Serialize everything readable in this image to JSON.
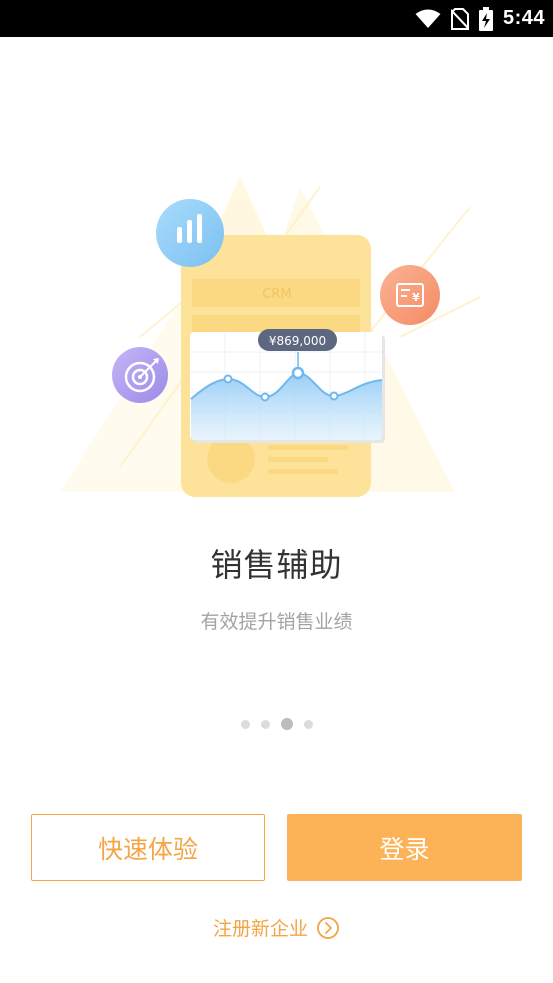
{
  "status_bar": {
    "time": "5:44",
    "icons": [
      "wifi-icon",
      "no-sim-icon",
      "battery-charging-icon"
    ]
  },
  "hero": {
    "price_tag": "¥869,000",
    "phone_label": "CRM",
    "icons": [
      "bar-chart-icon",
      "target-icon",
      "money-receipt-icon"
    ]
  },
  "slide": {
    "title": "销售辅助",
    "subtitle": "有效提升销售业绩",
    "current_page": 3,
    "total_pages": 4
  },
  "buttons": {
    "trial_label": "快速体验",
    "login_label": "登录"
  },
  "register": {
    "label": "注册新企业",
    "icon": "chevron-right-circle-icon"
  },
  "colors": {
    "accent": "#f5a546",
    "login_bg": "#fcb256"
  }
}
